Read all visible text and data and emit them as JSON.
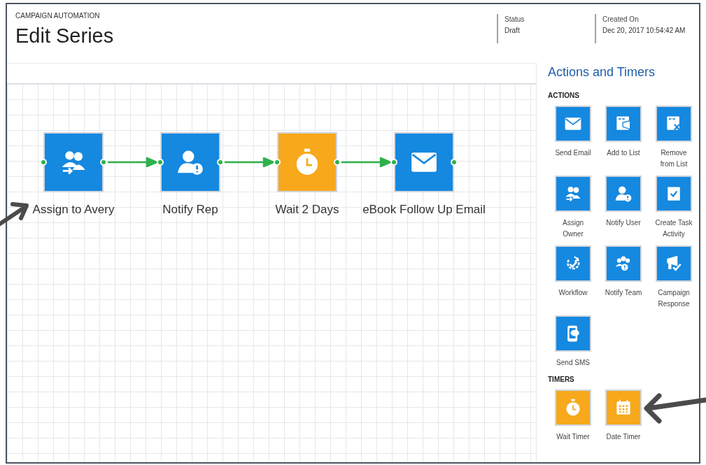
{
  "header": {
    "breadcrumb": "CAMPAIGN AUTOMATION",
    "title": "Edit Series",
    "fields": [
      {
        "label": "Status",
        "value": "Draft"
      },
      {
        "label": "Created On",
        "value": "Dec 20, 2017 10:54:42 AM"
      }
    ]
  },
  "canvas": {
    "nodes": [
      {
        "label": "Assign to Avery",
        "kind": "action"
      },
      {
        "label": "Notify Rep",
        "kind": "action"
      },
      {
        "label": "Wait 2 Days",
        "kind": "timer"
      },
      {
        "label": "eBook Follow Up Email",
        "kind": "action"
      }
    ]
  },
  "panel": {
    "title": "Actions and Timers",
    "sections": [
      {
        "heading": "ACTIONS",
        "items": [
          {
            "label": "Send Email",
            "kind": "action"
          },
          {
            "label": "Add to List",
            "kind": "action"
          },
          {
            "label": "Remove from List",
            "kind": "action"
          },
          {
            "label": "Assign Owner",
            "kind": "action"
          },
          {
            "label": "Notify User",
            "kind": "action"
          },
          {
            "label": "Create Task Activity",
            "kind": "action"
          },
          {
            "label": "Workflow",
            "kind": "action"
          },
          {
            "label": "Notify Team",
            "kind": "action"
          },
          {
            "label": "Campaign Response",
            "kind": "action"
          },
          {
            "label": "Send SMS",
            "kind": "action"
          }
        ]
      },
      {
        "heading": "TIMERS",
        "items": [
          {
            "label": "Wait Timer",
            "kind": "timer"
          },
          {
            "label": "Date Timer",
            "kind": "timer"
          }
        ]
      }
    ]
  }
}
